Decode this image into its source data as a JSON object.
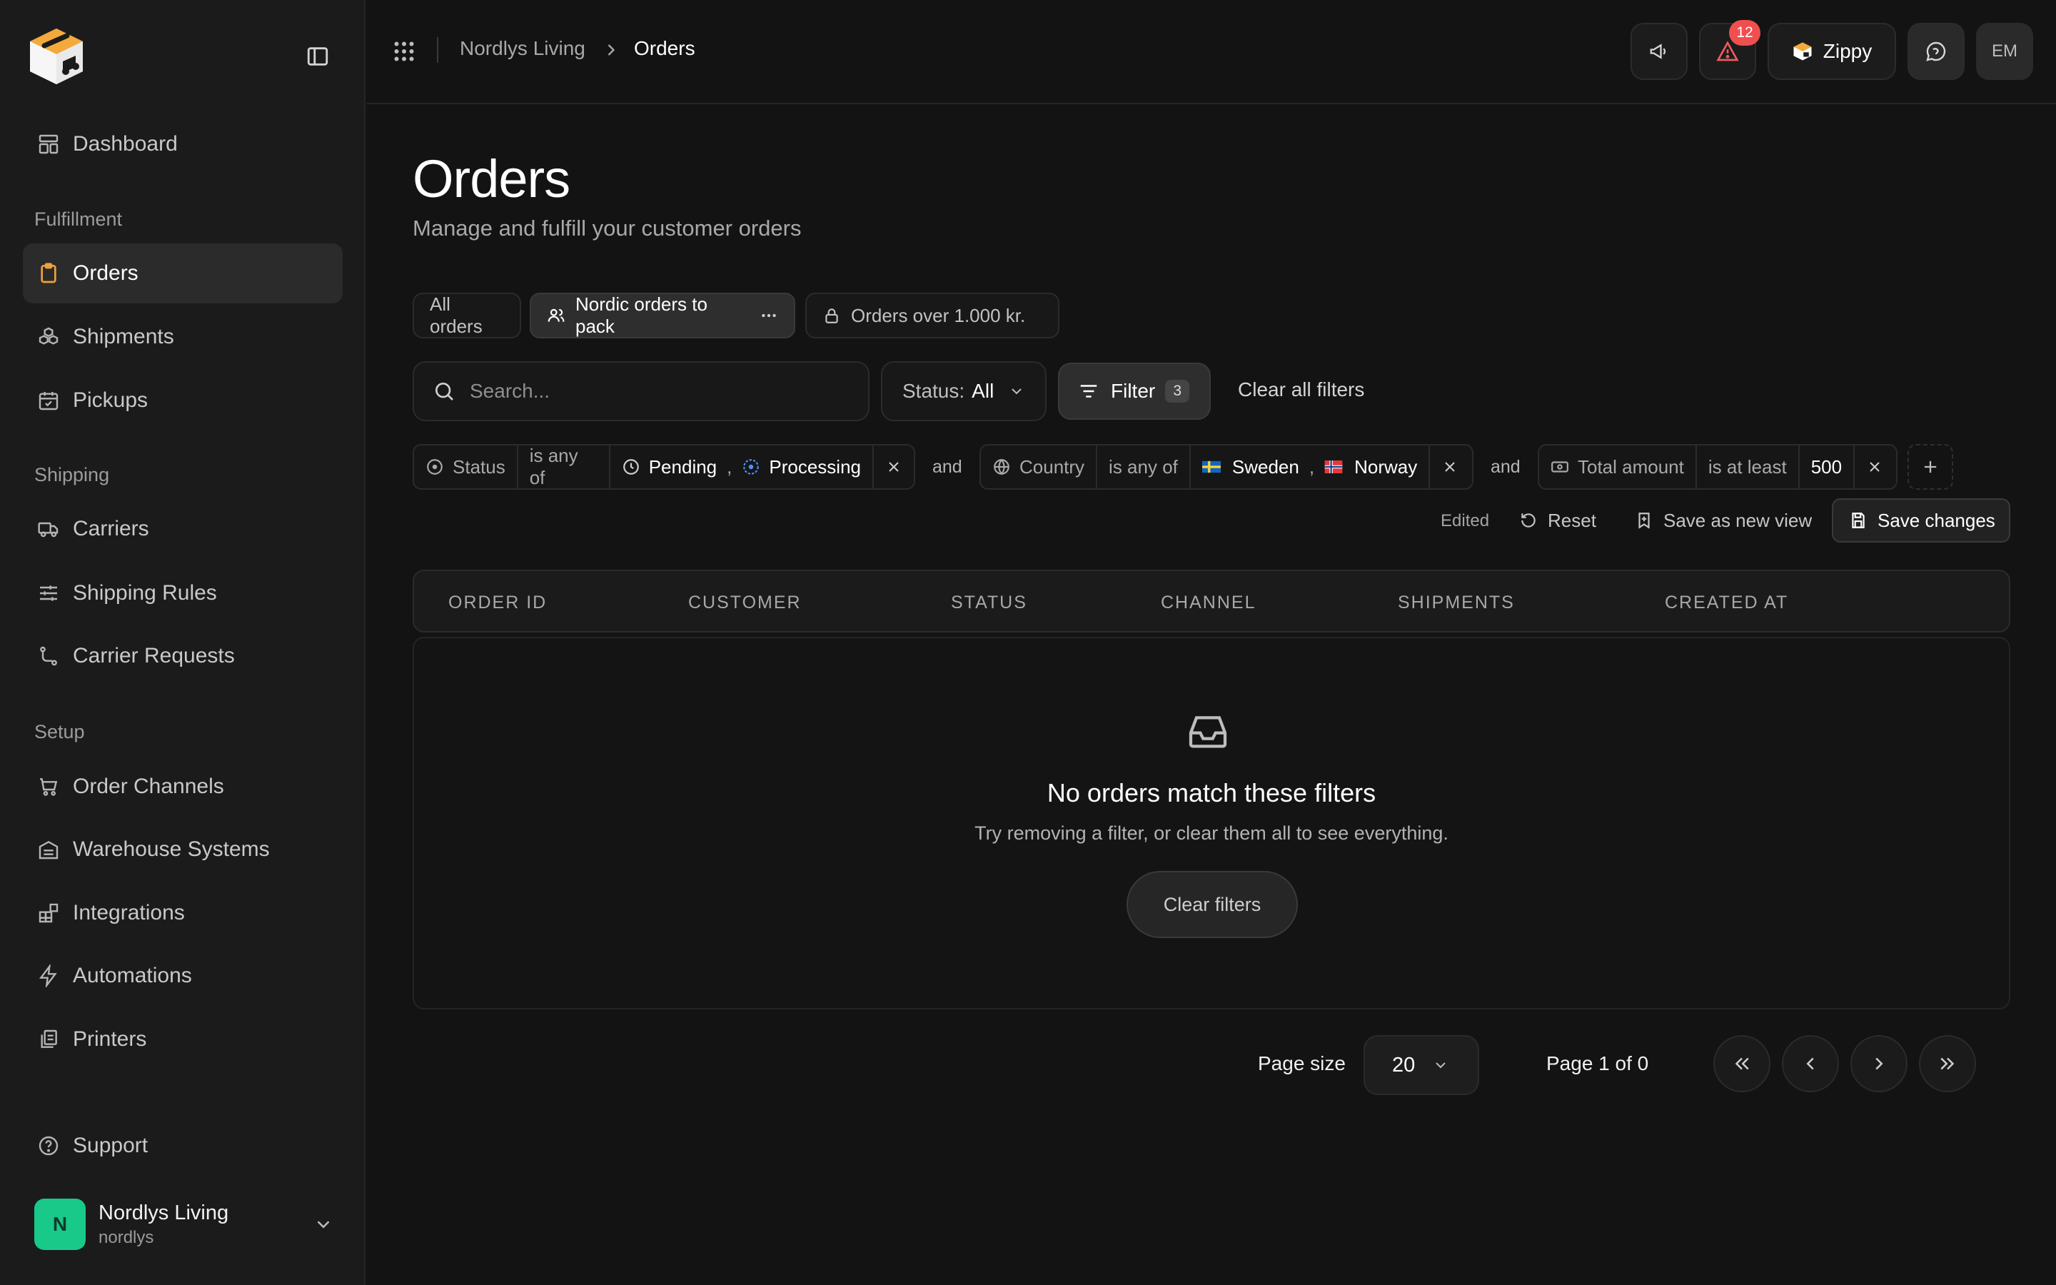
{
  "app": {
    "org_name": "Nordlys Living",
    "current_page": "Orders"
  },
  "sidebar": {
    "top_item": {
      "label": "Dashboard",
      "icon": "dashboard-icon"
    },
    "sections": [
      {
        "label": "Fulfillment",
        "items": [
          {
            "label": "Orders",
            "icon": "clipboard-icon",
            "active": true
          },
          {
            "label": "Shipments",
            "icon": "boxes-icon"
          },
          {
            "label": "Pickups",
            "icon": "calendar-check-icon"
          }
        ]
      },
      {
        "label": "Shipping",
        "items": [
          {
            "label": "Carriers",
            "icon": "truck-icon"
          },
          {
            "label": "Shipping Rules",
            "icon": "sliders-icon"
          },
          {
            "label": "Carrier Requests",
            "icon": "route-icon"
          }
        ]
      },
      {
        "label": "Setup",
        "items": [
          {
            "label": "Order Channels",
            "icon": "cart-icon"
          },
          {
            "label": "Warehouse Systems",
            "icon": "warehouse-icon"
          },
          {
            "label": "Integrations",
            "icon": "blocks-icon"
          },
          {
            "label": "Automations",
            "icon": "bolt-icon"
          },
          {
            "label": "Printers",
            "icon": "printer-icon"
          }
        ]
      }
    ],
    "support": {
      "label": "Support",
      "icon": "help-circle-icon"
    },
    "account": {
      "initial": "N",
      "name": "Nordlys Living",
      "handle": "nordlys"
    }
  },
  "topbar": {
    "notification_count": "12",
    "assistant_label": "Zippy",
    "user_initials": "EM"
  },
  "page": {
    "title": "Orders",
    "subtitle": "Manage and fulfill your customer orders"
  },
  "views": [
    {
      "label": "All orders"
    },
    {
      "label": "Nordic orders to pack",
      "active": true
    },
    {
      "label": "Orders over 1.000 kr."
    }
  ],
  "toolbar": {
    "search_placeholder": "Search...",
    "status_label": "Status:",
    "status_value": "All",
    "filter_label": "Filter",
    "filter_count": "3",
    "clear_all_label": "Clear all filters"
  },
  "filters": {
    "and_label": "and",
    "status": {
      "field": "Status",
      "operator": "is any of",
      "values": [
        "Pending",
        "Processing"
      ]
    },
    "country": {
      "field": "Country",
      "operator": "is any of",
      "values": [
        "Sweden",
        "Norway"
      ]
    },
    "amount": {
      "field": "Total amount",
      "operator": "is at least",
      "value": "500"
    }
  },
  "view_actions": {
    "edited_label": "Edited",
    "reset_label": "Reset",
    "save_new_label": "Save as new view",
    "save_changes_label": "Save changes"
  },
  "table": {
    "columns": [
      "ORDER ID",
      "CUSTOMER",
      "STATUS",
      "CHANNEL",
      "SHIPMENTS",
      "CREATED AT"
    ],
    "empty_title": "No orders match these filters",
    "empty_subtitle": "Try removing a filter, or clear them all to see everything.",
    "empty_action": "Clear filters"
  },
  "pagination": {
    "page_size_label": "Page size",
    "page_size": "20",
    "page_info": "Page 1 of 0"
  },
  "colors": {
    "accent": "#f0a23a",
    "avatar": "#18c98a",
    "badge": "#f04f4f"
  }
}
